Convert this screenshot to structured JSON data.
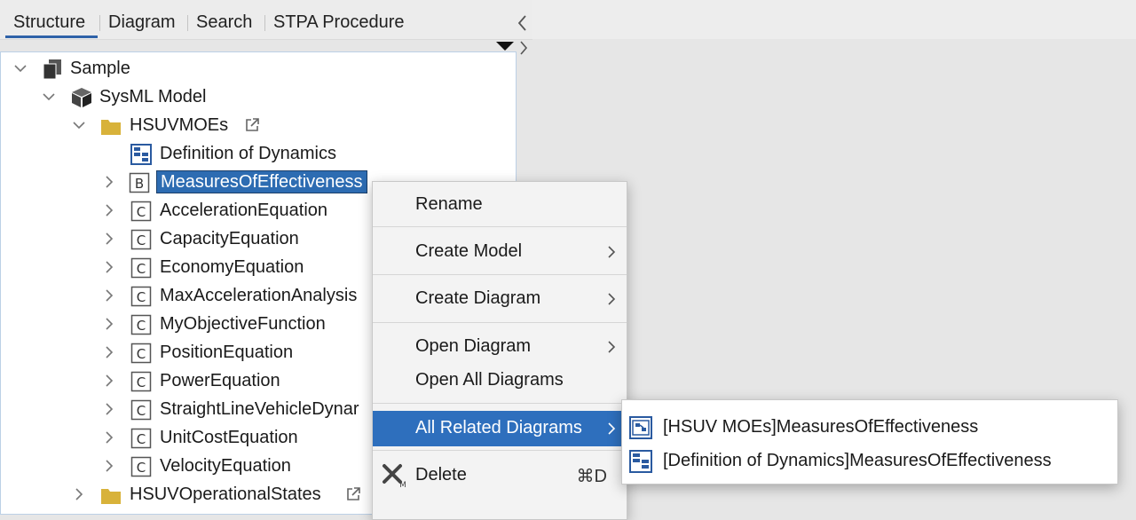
{
  "tabs": [
    {
      "label": "Structure",
      "active": true
    },
    {
      "label": "Diagram"
    },
    {
      "label": "Search"
    },
    {
      "label": "STPA Procedure"
    }
  ],
  "tree": {
    "root": "Sample",
    "model": "SysML Model",
    "package": "HSUVMOEs",
    "items": [
      {
        "label": "Definition of Dynamics",
        "icon": "diagram-icon"
      },
      {
        "label": "MeasuresOfEffectiveness",
        "icon": "block-icon",
        "selected": true
      },
      {
        "label": "AccelerationEquation",
        "icon": "constraint-icon"
      },
      {
        "label": "CapacityEquation",
        "icon": "constraint-icon"
      },
      {
        "label": "EconomyEquation",
        "icon": "constraint-icon"
      },
      {
        "label": "MaxAccelerationAnalysis",
        "icon": "constraint-icon"
      },
      {
        "label": "MyObjectiveFunction",
        "icon": "constraint-icon"
      },
      {
        "label": "PositionEquation",
        "icon": "constraint-icon"
      },
      {
        "label": "PowerEquation",
        "icon": "constraint-icon"
      },
      {
        "label": "StraightLineVehicleDynar",
        "icon": "constraint-icon"
      },
      {
        "label": "UnitCostEquation",
        "icon": "constraint-icon"
      },
      {
        "label": "VelocityEquation",
        "icon": "constraint-icon"
      }
    ],
    "next_package": "HSUVOperationalStates",
    "icon_letters": {
      "block": "B",
      "constraint": "C"
    }
  },
  "context_menu": {
    "items": [
      {
        "label": "Rename"
      },
      {
        "label": "Create Model",
        "submenu": true
      },
      {
        "label": "Create Diagram",
        "submenu": true
      },
      {
        "label": "Open Diagram",
        "submenu": true
      },
      {
        "label": "Open All Diagrams"
      },
      {
        "label": "All Related Diagrams",
        "submenu": true,
        "active": true
      },
      {
        "label": "Delete",
        "shortcut": "⌘D",
        "icon": "delete-icon"
      }
    ]
  },
  "submenu": {
    "items": [
      {
        "label": "[HSUV MOEs]MeasuresOfEffectiveness",
        "icon": "ibd-diagram-icon"
      },
      {
        "label": "[Definition of Dynamics]MeasuresOfEffectiveness",
        "icon": "bdd-diagram-icon"
      }
    ]
  },
  "colors": {
    "selection": "#2d6cb2",
    "menu_active": "#2e6fbd",
    "folder": "#d8b23a"
  }
}
